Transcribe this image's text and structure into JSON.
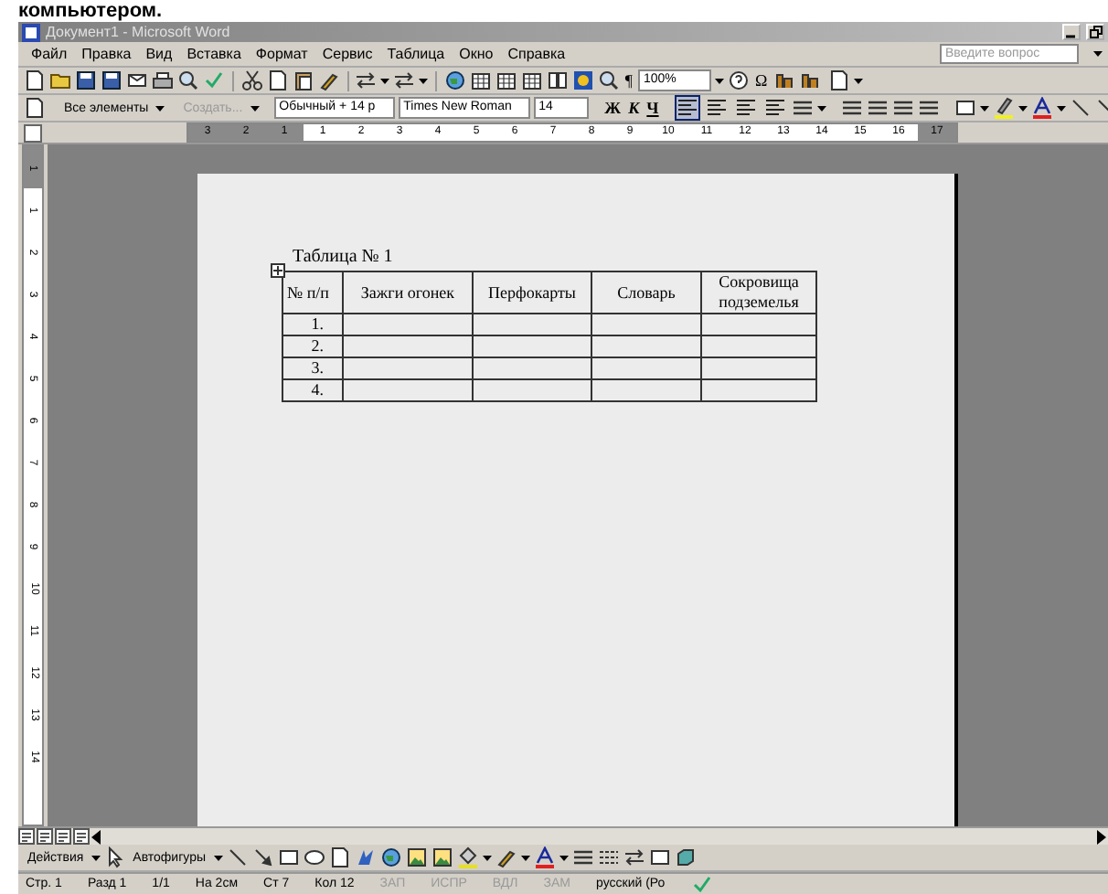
{
  "heading": {
    "text": "компьютером."
  },
  "window": {
    "title": "Документ1 - Microsoft Word"
  },
  "menu": [
    {
      "label": "Файл"
    },
    {
      "label": "Правка"
    },
    {
      "label": "Вид"
    },
    {
      "label": "Вставка"
    },
    {
      "label": "Формат"
    },
    {
      "label": "Сервис"
    },
    {
      "label": "Таблица"
    },
    {
      "label": "Окно"
    },
    {
      "label": "Справка"
    }
  ],
  "help_search": {
    "placeholder": "Введите вопрос"
  },
  "standard_toolbar": {
    "zoom": "100%",
    "show_marks_glyph": "¶",
    "symbol_glyph": "Ω"
  },
  "formatting_toolbar": {
    "reviewing": "Все элементы",
    "create": "Создать...",
    "style": "Обычный + 14 р",
    "font": "Times New Roman",
    "size": "14",
    "styles": [
      {
        "glyph": "Ж",
        "kind": "bold"
      },
      {
        "glyph": "К",
        "kind": "italic"
      },
      {
        "glyph": "Ч",
        "kind": "underline"
      }
    ],
    "alignments": [
      {
        "selected": true
      },
      {
        "selected": false
      },
      {
        "selected": false
      },
      {
        "selected": false
      }
    ]
  },
  "ruler": {
    "marks": [
      {
        "label": "3",
        "margin": true
      },
      {
        "label": "2",
        "margin": true
      },
      {
        "label": "1",
        "margin": true
      },
      {
        "label": "1",
        "margin": false
      },
      {
        "label": "2",
        "margin": false
      },
      {
        "label": "3",
        "margin": false
      },
      {
        "label": "4",
        "margin": false
      },
      {
        "label": "5",
        "margin": false
      },
      {
        "label": "6",
        "margin": false
      },
      {
        "label": "7",
        "margin": false
      },
      {
        "label": "8",
        "margin": false
      },
      {
        "label": "9",
        "margin": false
      },
      {
        "label": "10",
        "margin": false
      },
      {
        "label": "11",
        "margin": false
      },
      {
        "label": "12",
        "margin": false
      },
      {
        "label": "13",
        "margin": false
      },
      {
        "label": "14",
        "margin": false
      },
      {
        "label": "15",
        "margin": false
      },
      {
        "label": "16",
        "margin": false
      },
      {
        "label": "17",
        "margin": true
      }
    ]
  },
  "vertical_ruler": {
    "marks": [
      {
        "label": "1",
        "margin": true
      },
      {
        "label": "1",
        "margin": false
      },
      {
        "label": "2",
        "margin": false
      },
      {
        "label": "3",
        "margin": false
      },
      {
        "label": "4",
        "margin": false
      },
      {
        "label": "5",
        "margin": false
      },
      {
        "label": "6",
        "margin": false
      },
      {
        "label": "7",
        "margin": false
      },
      {
        "label": "8",
        "margin": false
      },
      {
        "label": "9",
        "margin": false
      },
      {
        "label": "10",
        "margin": false
      },
      {
        "label": "11",
        "margin": false
      },
      {
        "label": "12",
        "margin": false
      },
      {
        "label": "13",
        "margin": false
      },
      {
        "label": "14",
        "margin": false
      }
    ]
  },
  "document": {
    "caption": "Таблица № 1",
    "table": {
      "columns": [
        "№ п/п",
        "Зажги огонек",
        "Перфокарты",
        "Словарь",
        "Сокровища подземелья"
      ],
      "rows": [
        [
          "1."
        ],
        [
          "2."
        ],
        [
          "3."
        ],
        [
          "4."
        ]
      ]
    }
  },
  "drawing_toolbar": {
    "actions": "Действия",
    "autoshapes": "Автофигуры"
  },
  "status_bar": {
    "items": [
      {
        "text": "Стр. 1",
        "disabled": false
      },
      {
        "text": "Разд 1",
        "disabled": false
      },
      {
        "text": "1/1",
        "disabled": false
      },
      {
        "text": "На 2см",
        "disabled": false
      },
      {
        "text": "Ст 7",
        "disabled": false
      },
      {
        "text": "Кол 12",
        "disabled": false
      },
      {
        "text": "ЗАП",
        "disabled": true
      },
      {
        "text": "ИСПР",
        "disabled": true
      },
      {
        "text": "ВДЛ",
        "disabled": true
      },
      {
        "text": "ЗАМ",
        "disabled": true
      },
      {
        "text": "русский (Ро",
        "disabled": false
      }
    ]
  }
}
